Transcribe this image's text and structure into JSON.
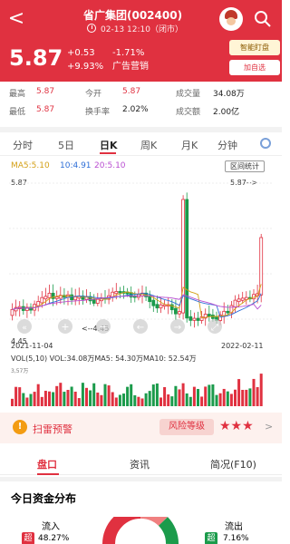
{
  "header": {
    "title": "省广集团(002400)",
    "subtitle": "02-13 12:10（闭市）",
    "back_label": "<",
    "price": "5.87",
    "change": "+0.53",
    "pct": "+9.93%",
    "right1": "-1.71%",
    "right2": "广告营销",
    "stare_label": "智能盯盘",
    "add_label": "加自选",
    "colors": {
      "red": "#e03140",
      "green": "#1b9b4b"
    }
  },
  "stats": {
    "high_label": "最高",
    "high": "5.87",
    "low_label": "最低",
    "low": "5.87",
    "open_label": "今开",
    "open": "5.87",
    "turnover_label": "换手率",
    "turnover": "2.02%",
    "vol_label": "成交量",
    "vol": "34.08万",
    "amount_label": "成交额",
    "amount": "2.00亿"
  },
  "tabs": [
    "分时",
    "5日",
    "日K",
    "周K",
    "月K",
    "分钟"
  ],
  "chart": {
    "ma5": "MA5:5.10",
    "ma10": "10:4.91",
    "ma20": "20:5.10",
    "region_label": "区间统计",
    "top_price": "5.87",
    "top_arrow": "5.87-->",
    "low_arrow": "<--4.45",
    "bottom_price": "4.45",
    "start_date": "2021-11-04",
    "end_date": "2022-02-11",
    "volume_line": "VOL(5,10)  VOL:34.08万MA5: 54.30万MA10: 52.54万",
    "vol_unit": "3,57万"
  },
  "chart_data": {
    "type": "candlestick",
    "title": "",
    "xlabel": "",
    "ylabel": "",
    "x_range": [
      "2021-11-04",
      "2022-02-11"
    ],
    "price_range": [
      4.45,
      5.87
    ],
    "ma": {
      "MA5": 5.1,
      "MA10": 4.91,
      "MA20": 5.1
    },
    "volume": {
      "VOL": "34.08万",
      "MA5": "54.30万",
      "MA10": "52.54万"
    }
  },
  "bar": {
    "warn": "扫雷预警",
    "risk": "风险等级",
    "stars": "★★★",
    "arrow": ">"
  },
  "bottom_tabs": [
    "盘口",
    "资讯",
    "简况(F10)"
  ],
  "fund": {
    "title": "今日资金分布",
    "in_label": "流入",
    "in_pct": "48.27%",
    "out_label": "流出",
    "out_pct": "7.16%",
    "in_box": "超",
    "out_box": "超"
  }
}
